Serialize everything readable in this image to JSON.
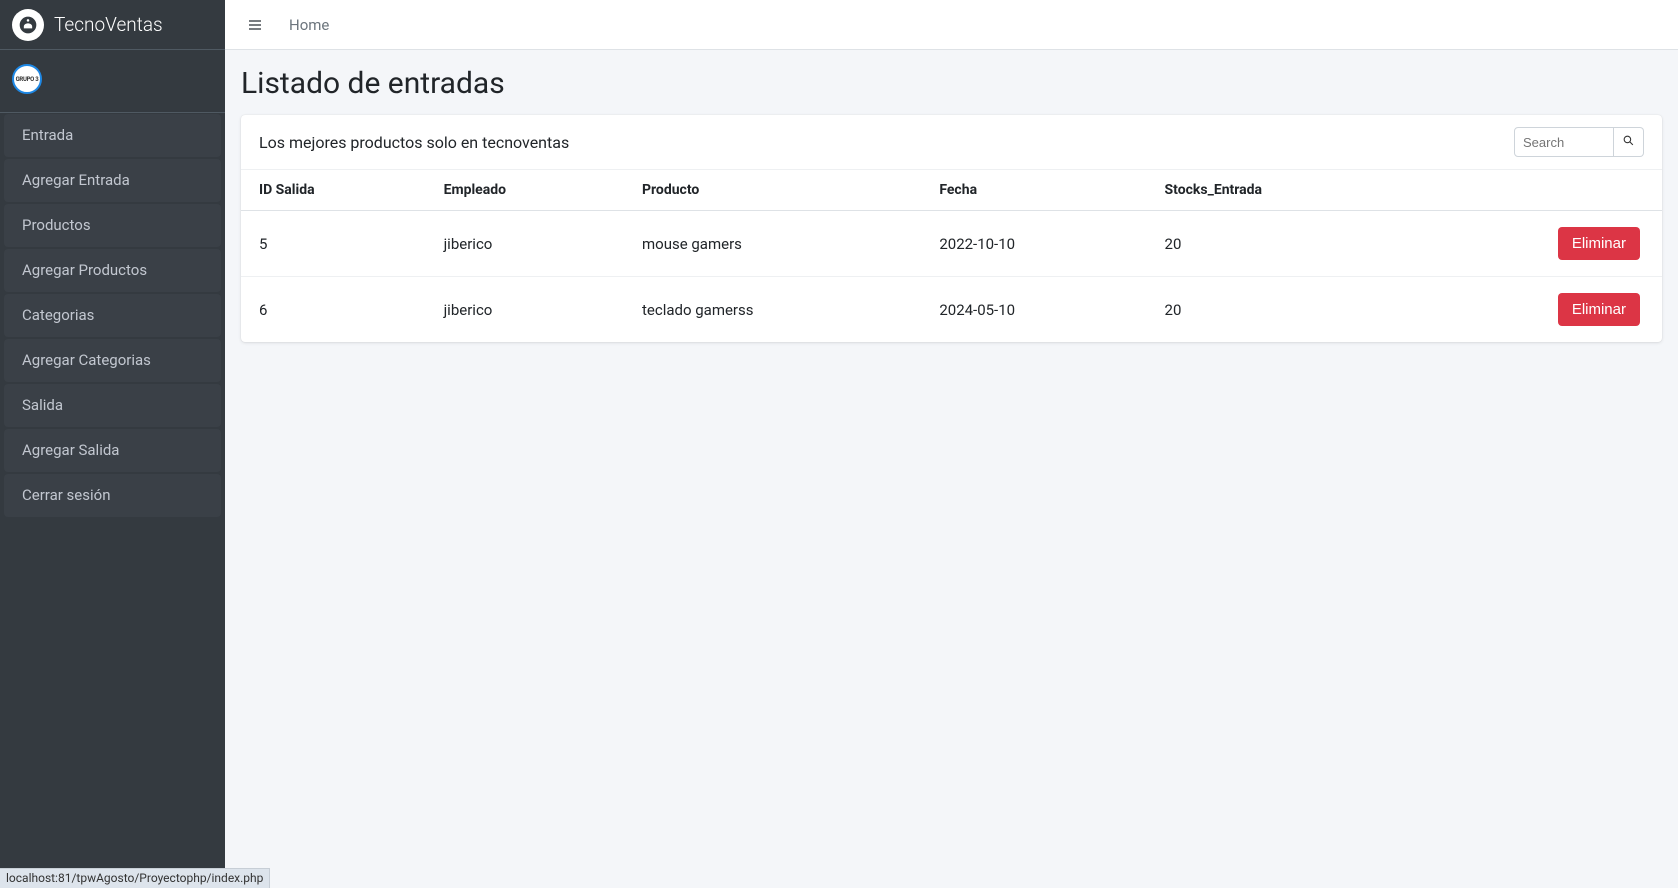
{
  "app": {
    "brand": "TecnoVentas",
    "avatar_text": "GRUPO 3"
  },
  "sidebar": {
    "items": [
      {
        "label": "Entrada"
      },
      {
        "label": "Agregar Entrada"
      },
      {
        "label": "Productos"
      },
      {
        "label": "Agregar Productos"
      },
      {
        "label": "Categorias"
      },
      {
        "label": "Agregar Categorias"
      },
      {
        "label": "Salida"
      },
      {
        "label": "Agregar Salida"
      },
      {
        "label": "Cerrar sesión"
      }
    ]
  },
  "breadcrumb": {
    "home": "Home"
  },
  "page": {
    "title": "Listado de entradas",
    "card_title": "Los mejores productos solo en tecnoventas",
    "search_placeholder": "Search"
  },
  "table": {
    "columns": [
      "ID Salida",
      "Empleado",
      "Producto",
      "Fecha",
      "Stocks_Entrada"
    ],
    "action_label": "Eliminar",
    "rows": [
      {
        "id": "5",
        "empleado": "jiberico",
        "producto": "mouse gamers",
        "fecha": "2022-10-10",
        "stocks": "20"
      },
      {
        "id": "6",
        "empleado": "jiberico",
        "producto": "teclado gamerss",
        "fecha": "2024-05-10",
        "stocks": "20"
      }
    ]
  },
  "status": {
    "url": "localhost:81/tpwAgosto/Proyectophp/index.php"
  }
}
